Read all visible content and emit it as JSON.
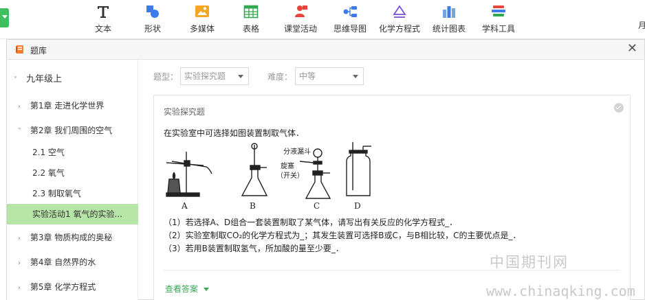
{
  "toolbar": {
    "items": [
      {
        "label": "文本",
        "icon": "text-icon"
      },
      {
        "label": "形状",
        "icon": "shape-icon"
      },
      {
        "label": "多媒体",
        "icon": "media-icon"
      },
      {
        "label": "表格",
        "icon": "table-icon"
      },
      {
        "label": "课堂活动",
        "icon": "classroom-activity-icon"
      },
      {
        "label": "思维导图",
        "icon": "mindmap-icon"
      },
      {
        "label": "化学方程式",
        "icon": "chemistry-equation-icon"
      },
      {
        "label": "统计图表",
        "icon": "statistics-chart-icon"
      },
      {
        "label": "学科工具",
        "icon": "subject-tools-icon"
      }
    ],
    "right_cut": "月"
  },
  "dialog": {
    "title": "题库",
    "close": "✕"
  },
  "sidebar": {
    "root": "九年级上",
    "items": [
      {
        "label": "第1章 走进化学世界",
        "chev": "›"
      },
      {
        "label": "第2章 我们周围的空气",
        "chev": "˅"
      },
      {
        "label": "2.1 空气"
      },
      {
        "label": "2.2 氧气"
      },
      {
        "label": "2.3 制取氧气"
      },
      {
        "label": "实验活动1 氧气的实验..."
      },
      {
        "label": "第3章 物质构成的奥秘",
        "chev": "›"
      },
      {
        "label": "第4章 自然界的水",
        "chev": "›"
      },
      {
        "label": "第5章 化学方程式",
        "chev": "›"
      }
    ],
    "active_index": 5
  },
  "filters": {
    "type_label": "题型：",
    "type_value": "实验探究题",
    "difficulty_label": "难度：",
    "difficulty_value": "中等"
  },
  "question": {
    "type": "实验探究题",
    "stem": "在实验室中可选择如图装置制取气体．",
    "figure_labels": {
      "funnel": "分液漏斗",
      "valve": "旋塞",
      "switch": "（开关）",
      "a": "A",
      "b": "B",
      "c": "C",
      "d": "D"
    },
    "q1": "（1）若选择A、D组合一套装置制取了某气体，请写出有关反应的化学方程式_．",
    "q2": "（2）实验室制取CO₂的化学方程式为_；其发生装置可选择B或C，与B相比较，C的主要优点是_．",
    "q3": "（3）若用B装置制取氢气，所加酸的量至少要_．",
    "view_answer": "查看答案"
  },
  "watermark": {
    "cn": "中国期刊网",
    "url": "www.chinaqking.com"
  },
  "colors": {
    "accent_green": "#3fbf5f",
    "active_bg": "#b7e5a8",
    "answer_green": "#3aa755"
  }
}
